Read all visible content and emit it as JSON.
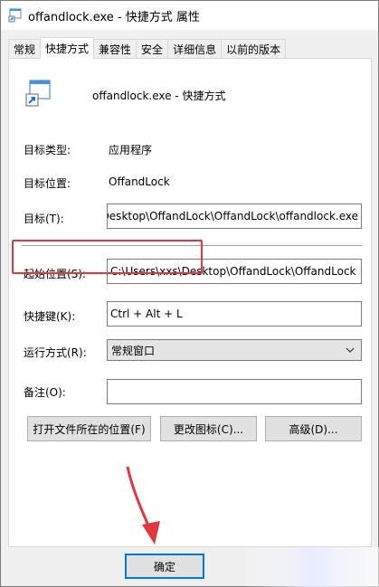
{
  "window": {
    "title": "offandlock.exe - 快捷方式 属性"
  },
  "tabs": [
    {
      "label": "常规",
      "active": false
    },
    {
      "label": "快捷方式",
      "active": true
    },
    {
      "label": "兼容性",
      "active": false
    },
    {
      "label": "安全",
      "active": false
    },
    {
      "label": "详细信息",
      "active": false
    },
    {
      "label": "以前的版本",
      "active": false
    }
  ],
  "header": {
    "name": "offandlock.exe - 快捷方式"
  },
  "fields": {
    "target_type_label": "目标类型:",
    "target_type_value": "应用程序",
    "target_location_label": "目标位置:",
    "target_location_value": "OffandLock",
    "target_label": "目标(T):",
    "target_value": "C:\\Users\\xxs\\Desktop\\OffandLock\\OffandLock\\offandlock.exe",
    "start_in_label": "起始位置(S):",
    "start_in_value": "C:\\Users\\xxs\\Desktop\\OffandLock\\OffandLock",
    "shortcut_key_label": "快捷键(K):",
    "shortcut_key_value": "Ctrl + Alt + L",
    "run_label": "运行方式(R):",
    "run_value": "常规窗口",
    "comment_label": "备注(O):",
    "comment_value": ""
  },
  "buttons": {
    "open_location": "打开文件所在的位置(F)",
    "change_icon": "更改图标(C)...",
    "advanced": "高级(D)...",
    "ok": "确定"
  },
  "colors": {
    "highlight": "#e0383e",
    "accent": "#0078d7"
  }
}
